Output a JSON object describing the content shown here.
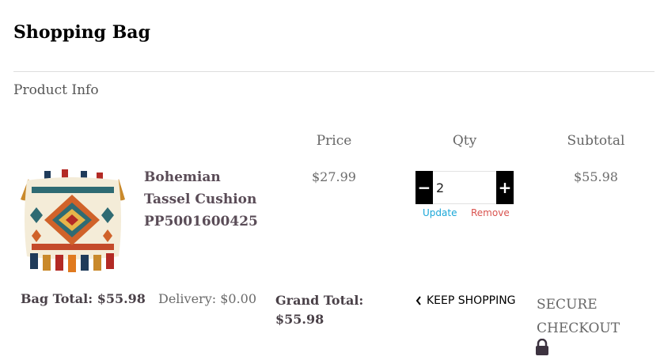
{
  "page": {
    "title": "Shopping Bag",
    "section_label": "Product Info"
  },
  "table": {
    "headers": {
      "price": "Price",
      "qty": "Qty",
      "subtotal": "Subtotal"
    }
  },
  "item": {
    "image_icon": "bohemian-cushion-image",
    "name": "Bohemian Tassel Cushion PP5001600425",
    "price": "$27.99",
    "quantity": "2",
    "subtotal": "$55.98",
    "minus_label": "−",
    "plus_label": "+",
    "update_label": "Update",
    "remove_label": "Remove"
  },
  "totals": {
    "bag_total": "Bag Total: $55.98",
    "delivery": "Delivery: $0.00",
    "grand_total": "Grand Total: $55.98"
  },
  "actions": {
    "keep_shopping": "KEEP SHOPPING",
    "secure_checkout": "SECURE CHECKOUT",
    "lock_icon": "lock-icon",
    "chevron_icon": "chevron-left-icon"
  },
  "colors": {
    "update_link": "#1aa7d8",
    "remove_link": "#d9534f",
    "qty_button": "#000000"
  }
}
